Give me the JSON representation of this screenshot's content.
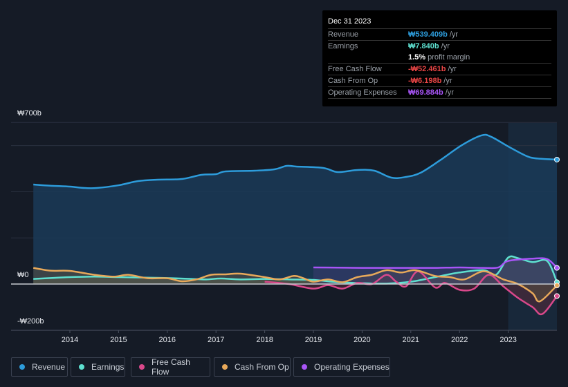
{
  "tooltip": {
    "date": "Dec 31 2023",
    "rows": [
      {
        "label": "Revenue",
        "value": "₩539.409b",
        "unit": "/yr",
        "color": "#2d9cdb"
      },
      {
        "label": "Earnings",
        "value": "₩7.840b",
        "unit": "/yr",
        "color": "#5ee0d0"
      },
      {
        "label": "",
        "value": "1.5%",
        "unit": "profit margin",
        "color": "#ffffff"
      },
      {
        "label": "Free Cash Flow",
        "value": "-₩52.461b",
        "unit": "/yr",
        "color": "#e84545"
      },
      {
        "label": "Cash From Op",
        "value": "-₩6.198b",
        "unit": "/yr",
        "color": "#e84545"
      },
      {
        "label": "Operating Expenses",
        "value": "₩69.884b",
        "unit": "/yr",
        "color": "#a855f7"
      }
    ]
  },
  "chart_data": {
    "type": "area",
    "title": "",
    "xlabel": "",
    "ylabel": "",
    "y_tick_labels": [
      {
        "value": 700,
        "label": "₩700b"
      },
      {
        "value": 0,
        "label": "₩0"
      },
      {
        "value": -200,
        "label": "-₩200b"
      }
    ],
    "ylim": [
      -200,
      700
    ],
    "xlim": [
      2013.25,
      2024.0
    ],
    "x_ticks": [
      "2014",
      "2015",
      "2016",
      "2017",
      "2018",
      "2019",
      "2020",
      "2021",
      "2022",
      "2023"
    ],
    "highlight_from": 2023.0,
    "series": [
      {
        "name": "Revenue",
        "color": "#2d9cdb",
        "points": [
          [
            2013.25,
            431
          ],
          [
            2013.6,
            426
          ],
          [
            2014.0,
            422
          ],
          [
            2014.3,
            416
          ],
          [
            2014.55,
            416
          ],
          [
            2015.0,
            428
          ],
          [
            2015.4,
            446
          ],
          [
            2015.8,
            452
          ],
          [
            2016.3,
            455
          ],
          [
            2016.7,
            473
          ],
          [
            2017.0,
            476
          ],
          [
            2017.2,
            488
          ],
          [
            2017.8,
            491
          ],
          [
            2018.2,
            497
          ],
          [
            2018.45,
            512
          ],
          [
            2018.65,
            509
          ],
          [
            2019.2,
            503
          ],
          [
            2019.5,
            485
          ],
          [
            2019.9,
            494
          ],
          [
            2020.25,
            491
          ],
          [
            2020.6,
            461
          ],
          [
            2020.9,
            464
          ],
          [
            2021.2,
            482
          ],
          [
            2021.6,
            536
          ],
          [
            2022.05,
            602
          ],
          [
            2022.45,
            644
          ],
          [
            2022.65,
            638
          ],
          [
            2023.0,
            596
          ],
          [
            2023.35,
            557
          ],
          [
            2023.55,
            545
          ],
          [
            2024.0,
            539
          ]
        ]
      },
      {
        "name": "Earnings",
        "color": "#5ee0d0",
        "points": [
          [
            2013.25,
            22
          ],
          [
            2013.6,
            26
          ],
          [
            2014.0,
            30
          ],
          [
            2014.5,
            32
          ],
          [
            2015.0,
            30
          ],
          [
            2015.5,
            28
          ],
          [
            2016.0,
            26
          ],
          [
            2016.5,
            22
          ],
          [
            2016.8,
            20
          ],
          [
            2017.1,
            24
          ],
          [
            2017.5,
            20
          ],
          [
            2018.0,
            22
          ],
          [
            2018.5,
            20
          ],
          [
            2019.0,
            18
          ],
          [
            2019.5,
            8
          ],
          [
            2020.0,
            4
          ],
          [
            2020.5,
            2
          ],
          [
            2021.0,
            10
          ],
          [
            2021.5,
            30
          ],
          [
            2022.0,
            50
          ],
          [
            2022.5,
            60
          ],
          [
            2022.75,
            40
          ],
          [
            2023.0,
            115
          ],
          [
            2023.2,
            112
          ],
          [
            2023.5,
            95
          ],
          [
            2023.8,
            100
          ],
          [
            2024.0,
            8
          ]
        ]
      },
      {
        "name": "Free Cash Flow",
        "color": "#d9488b",
        "points": [
          [
            2018.0,
            10
          ],
          [
            2018.5,
            0
          ],
          [
            2019.0,
            -20
          ],
          [
            2019.3,
            -5
          ],
          [
            2019.6,
            -20
          ],
          [
            2019.9,
            5
          ],
          [
            2020.2,
            0
          ],
          [
            2020.5,
            40
          ],
          [
            2020.7,
            10
          ],
          [
            2020.9,
            -10
          ],
          [
            2021.15,
            55
          ],
          [
            2021.5,
            -15
          ],
          [
            2021.7,
            5
          ],
          [
            2022.0,
            -25
          ],
          [
            2022.3,
            -20
          ],
          [
            2022.6,
            40
          ],
          [
            2022.9,
            -10
          ],
          [
            2023.2,
            -60
          ],
          [
            2023.5,
            -100
          ],
          [
            2023.7,
            -130
          ],
          [
            2024.0,
            -52
          ]
        ]
      },
      {
        "name": "Cash From Op",
        "color": "#e8a95a",
        "points": [
          [
            2013.25,
            70
          ],
          [
            2013.6,
            58
          ],
          [
            2014.0,
            57
          ],
          [
            2014.5,
            40
          ],
          [
            2014.9,
            32
          ],
          [
            2015.2,
            40
          ],
          [
            2015.6,
            25
          ],
          [
            2016.0,
            25
          ],
          [
            2016.3,
            12
          ],
          [
            2016.6,
            20
          ],
          [
            2016.9,
            40
          ],
          [
            2017.2,
            42
          ],
          [
            2017.5,
            45
          ],
          [
            2018.0,
            30
          ],
          [
            2018.3,
            20
          ],
          [
            2018.6,
            35
          ],
          [
            2018.8,
            25
          ],
          [
            2019.0,
            10
          ],
          [
            2019.3,
            20
          ],
          [
            2019.6,
            8
          ],
          [
            2019.9,
            30
          ],
          [
            2020.2,
            40
          ],
          [
            2020.5,
            60
          ],
          [
            2020.8,
            50
          ],
          [
            2021.1,
            60
          ],
          [
            2021.5,
            35
          ],
          [
            2021.8,
            30
          ],
          [
            2022.1,
            20
          ],
          [
            2022.5,
            55
          ],
          [
            2022.9,
            20
          ],
          [
            2023.2,
            0
          ],
          [
            2023.5,
            -40
          ],
          [
            2023.65,
            -75
          ],
          [
            2024.0,
            -6
          ]
        ]
      },
      {
        "name": "Operating Expenses",
        "color": "#a855f7",
        "points": [
          [
            2019.0,
            72
          ],
          [
            2019.5,
            71
          ],
          [
            2020.0,
            70
          ],
          [
            2020.5,
            70
          ],
          [
            2021.0,
            70
          ],
          [
            2021.5,
            70
          ],
          [
            2022.0,
            72
          ],
          [
            2022.5,
            70
          ],
          [
            2022.8,
            72
          ],
          [
            2023.0,
            100
          ],
          [
            2023.5,
            110
          ],
          [
            2023.8,
            108
          ],
          [
            2024.0,
            70
          ]
        ]
      }
    ],
    "legend": [
      "Revenue",
      "Earnings",
      "Free Cash Flow",
      "Cash From Op",
      "Operating Expenses"
    ],
    "legend_position": "bottom-left"
  }
}
